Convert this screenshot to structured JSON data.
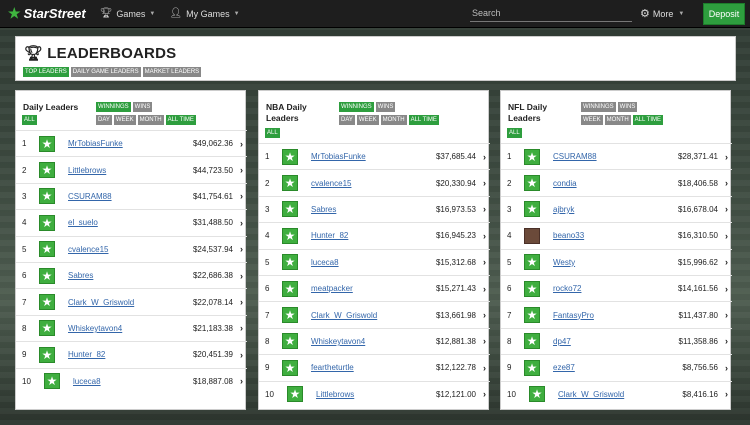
{
  "nav": {
    "logo": "StarStreet",
    "games": "Games",
    "my_games": "My Games",
    "search_placeholder": "Search",
    "more": "More",
    "deposit": "Deposit"
  },
  "header": {
    "title": "LEADERBOARDS",
    "tabs": [
      "TOP LEADERS",
      "DAILY GAME LEADERS",
      "MARKET LEADERS"
    ]
  },
  "boards": [
    {
      "title_line1": "Daily Leaders",
      "title_line2": "",
      "tags": [
        "WINNINGS",
        "WINS",
        "ALL",
        "DAY",
        "WEEK",
        "MONTH",
        "ALL TIME"
      ],
      "rows": [
        {
          "rank": "1",
          "name": "MrTobiasFunke",
          "amount": "$49,062.36"
        },
        {
          "rank": "2",
          "name": "Littlebrows",
          "amount": "$44,723.50"
        },
        {
          "rank": "3",
          "name": "CSURAM88",
          "amount": "$41,754.61"
        },
        {
          "rank": "4",
          "name": "el_suelo",
          "amount": "$31,488.50"
        },
        {
          "rank": "5",
          "name": "cvalence15",
          "amount": "$24,537.94"
        },
        {
          "rank": "6",
          "name": "Sabres",
          "amount": "$22,686.38"
        },
        {
          "rank": "7",
          "name": "Clark_W_Griswold",
          "amount": "$22,078.14"
        },
        {
          "rank": "8",
          "name": "Whiskeytavon4",
          "amount": "$21,183.38"
        },
        {
          "rank": "9",
          "name": "Hunter_82",
          "amount": "$20,451.39"
        },
        {
          "rank": "10",
          "name": "luceca8",
          "amount": "$18,887.08"
        }
      ]
    },
    {
      "title_line1": "NBA Daily",
      "title_line2": "Leaders",
      "tags": [
        "WINNINGS",
        "WINS",
        "DAY",
        "WEEK",
        "MONTH",
        "ALL TIME",
        "ALL"
      ],
      "rows": [
        {
          "rank": "1",
          "name": "MrTobiasFunke",
          "amount": "$37,685.44"
        },
        {
          "rank": "2",
          "name": "cvalence15",
          "amount": "$20,330.94"
        },
        {
          "rank": "3",
          "name": "Sabres",
          "amount": "$16,973.53"
        },
        {
          "rank": "4",
          "name": "Hunter_82",
          "amount": "$16,945.23"
        },
        {
          "rank": "5",
          "name": "luceca8",
          "amount": "$15,312.68"
        },
        {
          "rank": "6",
          "name": "meatpacker",
          "amount": "$15,271.43"
        },
        {
          "rank": "7",
          "name": "Clark_W_Griswold",
          "amount": "$13,661.98"
        },
        {
          "rank": "8",
          "name": "Whiskeytavon4",
          "amount": "$12,881.38"
        },
        {
          "rank": "9",
          "name": "feartheturtle",
          "amount": "$12,122.78"
        },
        {
          "rank": "10",
          "name": "Littlebrows",
          "amount": "$12,121.00"
        }
      ]
    },
    {
      "title_line1": "NFL Daily",
      "title_line2": "Leaders",
      "tags": [
        "WINNINGS",
        "WINS",
        "WEEK",
        "MONTH",
        "ALL TIME",
        "ALL"
      ],
      "rows": [
        {
          "rank": "1",
          "name": "CSURAM88",
          "amount": "$28,371.41"
        },
        {
          "rank": "2",
          "name": "condia",
          "amount": "$18,406.58"
        },
        {
          "rank": "3",
          "name": "ajbryk",
          "amount": "$16,678.04"
        },
        {
          "rank": "4",
          "name": "beano33",
          "amount": "$16,310.50"
        },
        {
          "rank": "5",
          "name": "Westy",
          "amount": "$15,996.62"
        },
        {
          "rank": "6",
          "name": "rocko72",
          "amount": "$14,161.56"
        },
        {
          "rank": "7",
          "name": "FantasyPro",
          "amount": "$11,437.80"
        },
        {
          "rank": "8",
          "name": "dp47",
          "amount": "$11,358.86"
        },
        {
          "rank": "9",
          "name": "eze87",
          "amount": "$8,756.56"
        },
        {
          "rank": "10",
          "name": "Clark_W_Griswold",
          "amount": "$8,416.16"
        }
      ]
    }
  ],
  "colors": {
    "accent_green": "#2e9e3e",
    "tag_gray": "#888888",
    "link_blue": "#3366aa",
    "nav_bg": "#1e1e1e"
  }
}
